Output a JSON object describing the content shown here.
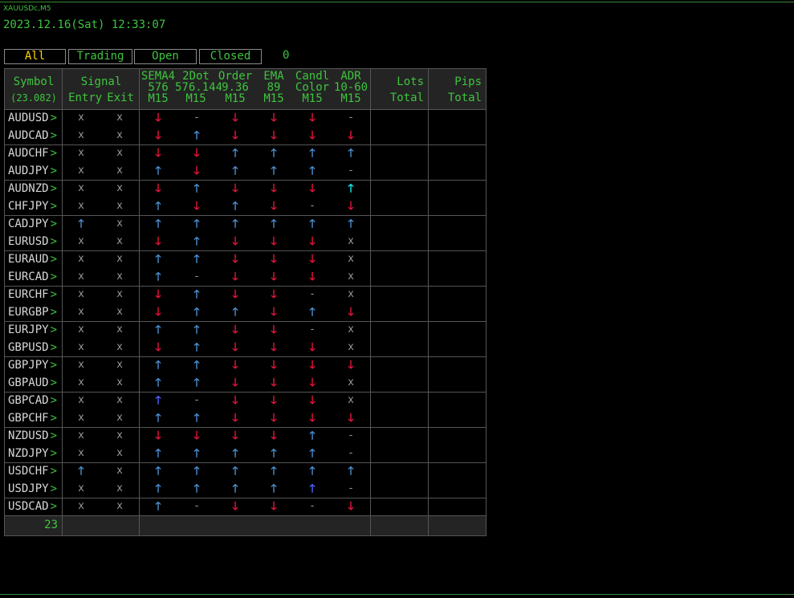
{
  "chart_symbol": "XAUUSDc,M5",
  "datetime": "2023.12.16(Sat) 12:33:07",
  "tabs": [
    "All",
    "Trading",
    "Open",
    "Closed"
  ],
  "active_tab": "All",
  "count": "0",
  "header": {
    "symbol": "Symbol",
    "symbol_sub": "(23.082)",
    "signal": "Signal",
    "entry": "Entry",
    "exit": "Exit",
    "ind1": [
      "SEMA4",
      "576",
      "M15"
    ],
    "ind2": [
      "2Dot",
      "576.144",
      "M15"
    ],
    "ind3": [
      "Order",
      "9.36",
      "M15"
    ],
    "ind4": [
      "EMA",
      "89",
      "M15"
    ],
    "ind5": [
      "Candl",
      "Color",
      "M15"
    ],
    "ind6": [
      "ADR",
      "10-60",
      "M15"
    ],
    "lots": [
      "Lots",
      "Total"
    ],
    "pips": [
      "Pips",
      "Total"
    ]
  },
  "symbol_chevron": ">",
  "glyphs": {
    "up": "🡑",
    "down": "🡓",
    "x": "x",
    "dash": "-"
  },
  "rows": [
    {
      "sym": "AUDUSD",
      "c": [
        "x",
        "x",
        "down",
        "dash",
        "down",
        "down",
        "down",
        "dash"
      ]
    },
    {
      "sym": "AUDCAD",
      "c": [
        "x",
        "x",
        "down",
        "up",
        "down",
        "down",
        "down",
        "down"
      ]
    },
    {
      "sym": "AUDCHF",
      "c": [
        "x",
        "x",
        "down",
        "down",
        "up",
        "up",
        "up",
        "up"
      ]
    },
    {
      "sym": "AUDJPY",
      "c": [
        "x",
        "x",
        "up",
        "down",
        "up",
        "up",
        "up",
        "dash"
      ]
    },
    {
      "sym": "AUDNZD",
      "c": [
        "x",
        "x",
        "down",
        "up",
        "down",
        "down",
        "down",
        "up-cyan"
      ]
    },
    {
      "sym": "CHFJPY",
      "c": [
        "x",
        "x",
        "up",
        "down",
        "up",
        "down",
        "dash",
        "down"
      ]
    },
    {
      "sym": "CADJPY",
      "c": [
        "up",
        "x",
        "up",
        "up",
        "up",
        "up",
        "up",
        "up"
      ]
    },
    {
      "sym": "EURUSD",
      "c": [
        "x",
        "x",
        "down",
        "up",
        "down",
        "down",
        "down",
        "x"
      ]
    },
    {
      "sym": "EURAUD",
      "c": [
        "x",
        "x",
        "up",
        "up",
        "down",
        "down",
        "down",
        "x"
      ]
    },
    {
      "sym": "EURCAD",
      "c": [
        "x",
        "x",
        "up",
        "dash",
        "down",
        "down",
        "down",
        "x"
      ]
    },
    {
      "sym": "EURCHF",
      "c": [
        "x",
        "x",
        "down",
        "up",
        "down",
        "down",
        "dash",
        "x"
      ]
    },
    {
      "sym": "EURGBP",
      "c": [
        "x",
        "x",
        "down",
        "up",
        "up",
        "down",
        "up",
        "down"
      ]
    },
    {
      "sym": "EURJPY",
      "c": [
        "x",
        "x",
        "up",
        "up",
        "down",
        "down",
        "dash",
        "x"
      ]
    },
    {
      "sym": "GBPUSD",
      "c": [
        "x",
        "x",
        "down",
        "up",
        "down",
        "down",
        "down",
        "x"
      ]
    },
    {
      "sym": "GBPJPY",
      "c": [
        "x",
        "x",
        "up",
        "up",
        "down",
        "down",
        "down",
        "down"
      ]
    },
    {
      "sym": "GBPAUD",
      "c": [
        "x",
        "x",
        "up",
        "up",
        "down",
        "down",
        "down",
        "x"
      ]
    },
    {
      "sym": "GBPCAD",
      "c": [
        "x",
        "x",
        "up-blue",
        "dash",
        "down",
        "down",
        "down",
        "x"
      ]
    },
    {
      "sym": "GBPCHF",
      "c": [
        "x",
        "x",
        "up",
        "up",
        "down",
        "down",
        "down",
        "down"
      ]
    },
    {
      "sym": "NZDUSD",
      "c": [
        "x",
        "x",
        "down",
        "down",
        "down",
        "down",
        "up",
        "dash"
      ]
    },
    {
      "sym": "NZDJPY",
      "c": [
        "x",
        "x",
        "up",
        "up",
        "up",
        "up",
        "up",
        "dash"
      ]
    },
    {
      "sym": "USDCHF",
      "c": [
        "up",
        "x",
        "up",
        "up",
        "up",
        "up",
        "up",
        "up"
      ]
    },
    {
      "sym": "USDJPY",
      "c": [
        "x",
        "x",
        "up",
        "up",
        "up",
        "up",
        "up-blue",
        "dash"
      ]
    },
    {
      "sym": "USDCAD",
      "c": [
        "x",
        "x",
        "up",
        "dash",
        "down",
        "down",
        "dash",
        "down"
      ]
    }
  ],
  "footer_count": "23",
  "colors": {
    "green": "#3ec43e",
    "up": "#4a8fcf",
    "down": "#e8143c",
    "up_cyan": "#10e8e8",
    "up_blue": "#4f60ff",
    "active_tab": "#ffd400"
  }
}
